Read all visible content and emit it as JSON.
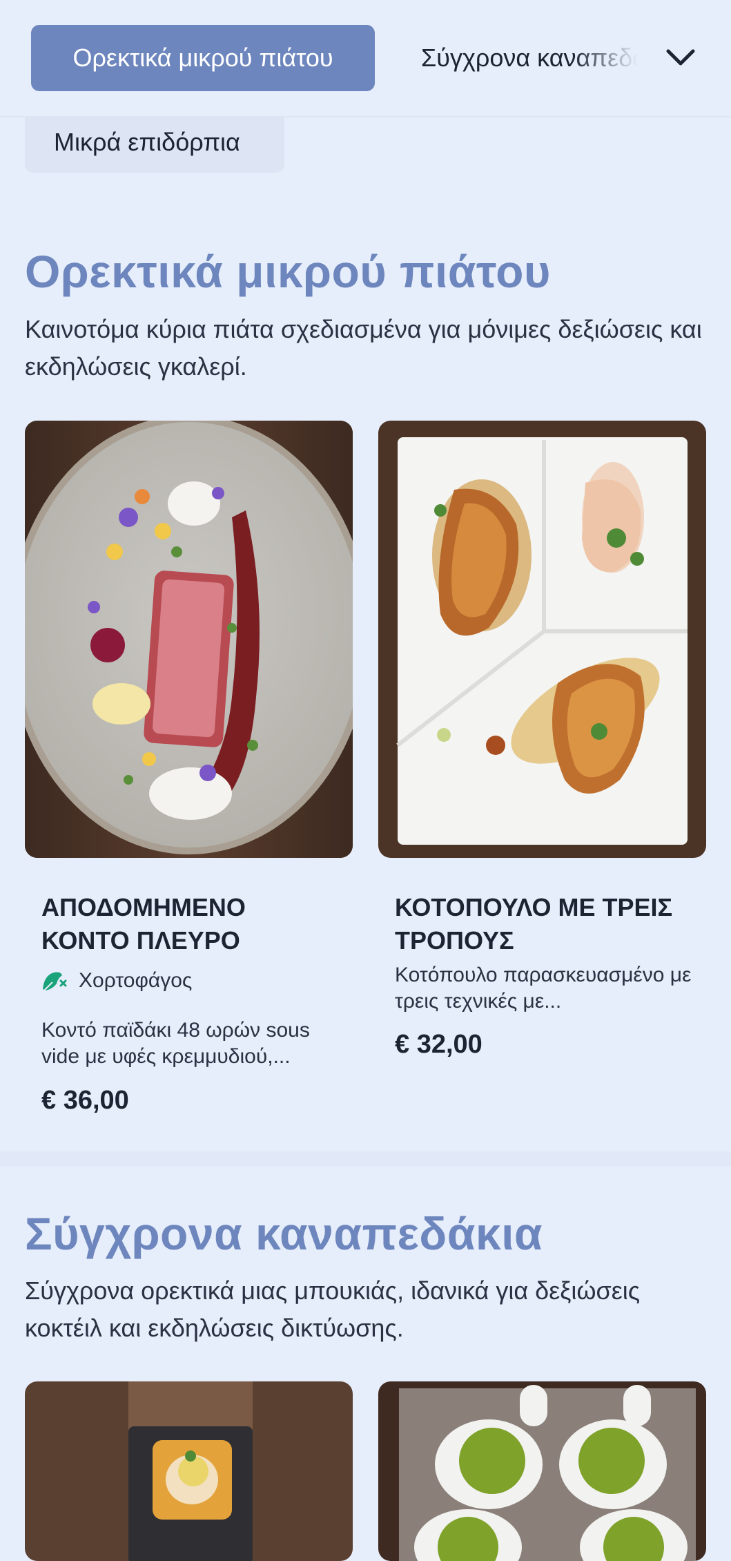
{
  "nav": {
    "active_tab": "Ορεκτικά μικρού πιάτου",
    "next_tab": "Σύγχρονα καναπεδάκια",
    "sub_tab": "Μικρά επιδόρπια"
  },
  "sections": [
    {
      "title": "Ορεκτικά μικρού πιάτου",
      "description": "Καινοτόμα κύρια πιάτα σχεδιασμένα για μόνιμες δεξιώσεις και εκδηλώσεις γκαλερί.",
      "items": [
        {
          "name": "ΑΠΟΔΟΜΗΜΕΝΟ ΚΟΝΤΟ ΠΛΕΥΡΟ",
          "badge": "Χορτοφάγος",
          "description": "Κοντό παϊδάκι 48 ωρών sous vide με υφές κρεμμυδιού,...",
          "price": "€ 36,00"
        },
        {
          "name": "ΚΟΤΟΠΟΥΛΟ ΜΕ ΤΡΕΙΣ ΤΡΟΠΟΥΣ",
          "description": "Κοτόπουλο παρασκευασμένο με τρεις τεχνικές με...",
          "price": "€ 32,00"
        }
      ]
    },
    {
      "title": "Σύγχρονα καναπεδάκια",
      "description": "Σύγχρονα ορεκτικά μιας μπουκιάς, ιδανικά για δεξιώσεις κοκτέιλ και εκδηλώσεις δικτύωσης."
    }
  ],
  "colors": {
    "background": "#e6edfb",
    "accent": "#6d86bd",
    "veg_icon": "#1aa37a"
  },
  "icons": {
    "dropdown": "chevron-down-icon",
    "vegetarian": "vegetarian-leaf-icon"
  }
}
